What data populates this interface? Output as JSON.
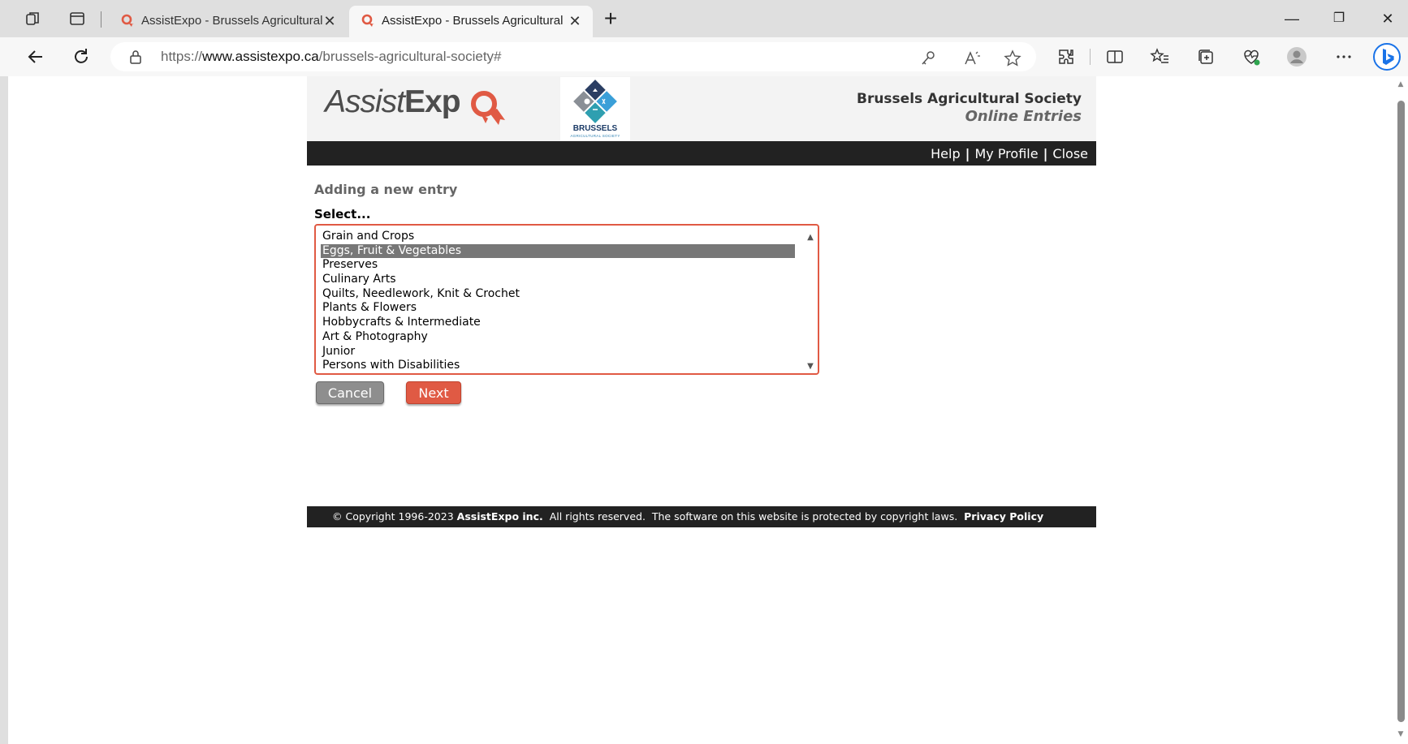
{
  "browser": {
    "tabs": [
      {
        "title": "AssistExpo - Brussels Agricultural",
        "active": false
      },
      {
        "title": "AssistExpo - Brussels Agricultural",
        "active": true
      }
    ],
    "close_glyph": "✕",
    "new_tab_glyph": "+",
    "window_controls": {
      "minimize": "—",
      "restore": "❐",
      "close": "✕"
    },
    "url": {
      "scheme": "https://",
      "host": "www.assistexpo.ca",
      "path": "/brussels-agricultural-society#"
    },
    "accent_color": "#1a73e8"
  },
  "header": {
    "logo_assist": "Assist",
    "logo_expo": "Exp",
    "society_logo_name": "BRUSSELS",
    "society_logo_sub": "AGRICULTURAL SOCIETY",
    "title": "Brussels Agricultural Society",
    "subtitle": "Online Entries"
  },
  "menu": {
    "help": "Help",
    "profile": "My Profile",
    "close": "Close",
    "separator": "|"
  },
  "form": {
    "heading": "Adding a new entry",
    "select_label": "Select...",
    "options": [
      "Grain and Crops",
      "Eggs, Fruit & Vegetables",
      "Preserves",
      "Culinary Arts",
      "Quilts, Needlework, Knit & Crochet",
      "Plants & Flowers",
      "Hobbycrafts & Intermediate",
      "Art & Photography",
      "Junior",
      "Persons with Disabilities"
    ],
    "selected_option": "Eggs, Fruit & Vegetables",
    "cancel_label": "Cancel",
    "next_label": "Next",
    "accent_color": "#e05a44"
  },
  "footer": {
    "copyright": "© Copyright 1996-2023",
    "company": "AssistExpo inc.",
    "rights": "All rights reserved.  The software on this website is protected by copyright laws.",
    "privacy": "Privacy Policy"
  }
}
